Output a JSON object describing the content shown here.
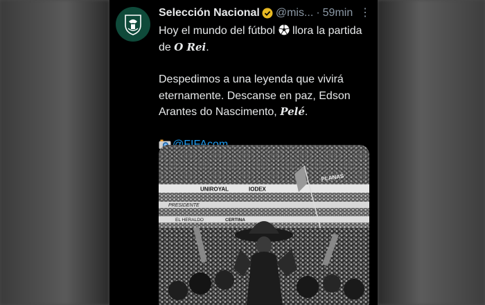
{
  "tweet": {
    "display_name": "Selección Nacional",
    "handle": "@mis...",
    "separator": "·",
    "time": "59min",
    "more": "⋮",
    "line1_pre": "Hoy el mundo del fútbol",
    "line1_post": "llora la partida de",
    "o_rei": "O Rei",
    "period1": ".",
    "para2": "Despedimos a una leyenda que vivirá eternamente. Descanse en paz, Edson Arantes do Nascimento,",
    "pele": "Pelé",
    "period2": ".",
    "mention": "@FIFAcom",
    "icons": {
      "avatar": "mexico-crest-icon",
      "verified": "verified-badge-icon",
      "ball": "soccer-ball-icon",
      "camera": "camera-icon"
    },
    "photo_banner_texts": [
      "UNIROYAL",
      "IODEX",
      "PLANAS",
      "PRESIDENTE",
      "EL HERALDO",
      "CERTINA"
    ]
  },
  "colors": {
    "background": "#000000",
    "text": "#e7e9ea",
    "secondary": "#8b98a5",
    "link": "#1d9bf0",
    "verified": "#e8b923",
    "avatar_bg": "#0f4a3a"
  }
}
